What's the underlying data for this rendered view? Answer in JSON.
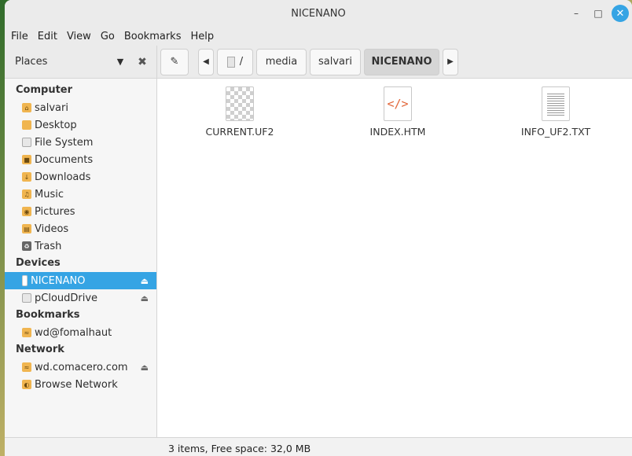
{
  "window": {
    "title": "NICENANO"
  },
  "menu": [
    "File",
    "Edit",
    "View",
    "Go",
    "Bookmarks",
    "Help"
  ],
  "places": {
    "label": "Places"
  },
  "path": [
    "/",
    "media",
    "salvari",
    "NICENANO"
  ],
  "sidebar": {
    "computer": {
      "heading": "Computer",
      "items": [
        "salvari",
        "Desktop",
        "File System",
        "Documents",
        "Downloads",
        "Music",
        "Pictures",
        "Videos",
        "Trash"
      ]
    },
    "devices": {
      "heading": "Devices",
      "items": [
        "NICENANO",
        "pCloudDrive"
      ]
    },
    "bookmarks": {
      "heading": "Bookmarks",
      "items": [
        "wd@fomalhaut"
      ]
    },
    "network": {
      "heading": "Network",
      "items": [
        "wd.comacero.com",
        "Browse Network"
      ]
    }
  },
  "files": [
    "CURRENT.UF2",
    "INDEX.HTM",
    "INFO_UF2.TXT"
  ],
  "status": "3 items, Free space: 32,0 MB",
  "colors": {
    "accent": "#35a4e4",
    "folder": "#f0b550",
    "code": "#e2673a"
  }
}
